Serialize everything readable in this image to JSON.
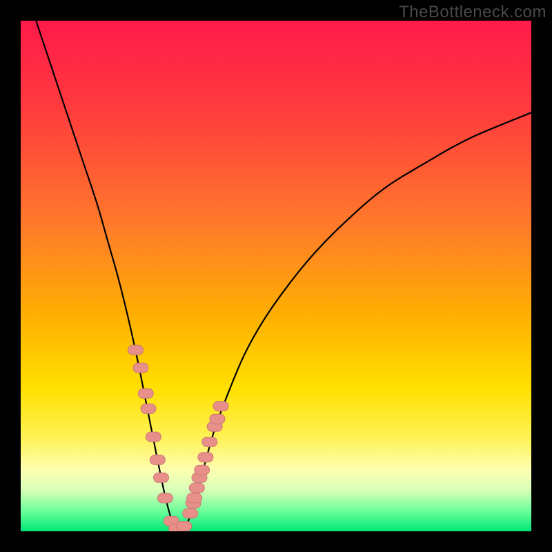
{
  "watermark": "TheBottleneck.com",
  "colors": {
    "frame": "#000000",
    "gradient_stops": [
      {
        "offset": 0.0,
        "color": "#ff1a4a"
      },
      {
        "offset": 0.18,
        "color": "#ff3d3d"
      },
      {
        "offset": 0.4,
        "color": "#ff7a2a"
      },
      {
        "offset": 0.58,
        "color": "#ffb000"
      },
      {
        "offset": 0.72,
        "color": "#ffe000"
      },
      {
        "offset": 0.82,
        "color": "#fff35a"
      },
      {
        "offset": 0.88,
        "color": "#fdffb0"
      },
      {
        "offset": 0.92,
        "color": "#d8ffb8"
      },
      {
        "offset": 0.96,
        "color": "#6dff9a"
      },
      {
        "offset": 1.0,
        "color": "#00e676"
      }
    ],
    "curve": "#000000",
    "marker_fill": "#e88f8a",
    "marker_stroke": "#c97a75"
  },
  "chart_data": {
    "type": "line",
    "title": "",
    "xlabel": "",
    "ylabel": "",
    "xlim": [
      0,
      100
    ],
    "ylim": [
      0,
      100
    ],
    "series": [
      {
        "name": "bottleneck-curve",
        "x": [
          3,
          6,
          9,
          12,
          15,
          17,
          19,
          21,
          23,
          25,
          27,
          28.5,
          30,
          31,
          32,
          33,
          34,
          36,
          38,
          41,
          44,
          48,
          53,
          58,
          64,
          71,
          79,
          88,
          100
        ],
        "y": [
          100,
          91,
          82,
          73,
          64,
          57,
          50,
          42,
          33,
          23,
          13,
          6,
          1,
          0,
          0.5,
          2.5,
          6,
          13,
          20,
          28,
          35,
          42,
          49,
          55,
          61,
          67,
          72,
          77,
          82
        ]
      }
    ],
    "markers": {
      "name": "highlighted-points",
      "x": [
        22.5,
        23.5,
        24.5,
        25.0,
        26.0,
        26.8,
        27.5,
        28.3,
        29.5,
        30.5,
        32.0,
        33.2,
        33.8,
        34.0,
        34.5,
        35.0,
        35.5,
        36.2,
        37.0,
        38.0,
        38.5,
        39.2
      ],
      "y": [
        35.5,
        32.0,
        27.0,
        24.0,
        18.5,
        14.0,
        10.5,
        6.5,
        2.0,
        0.5,
        1.0,
        3.5,
        5.5,
        6.5,
        8.5,
        10.5,
        12.0,
        14.5,
        17.5,
        20.5,
        22.0,
        24.5
      ]
    }
  }
}
